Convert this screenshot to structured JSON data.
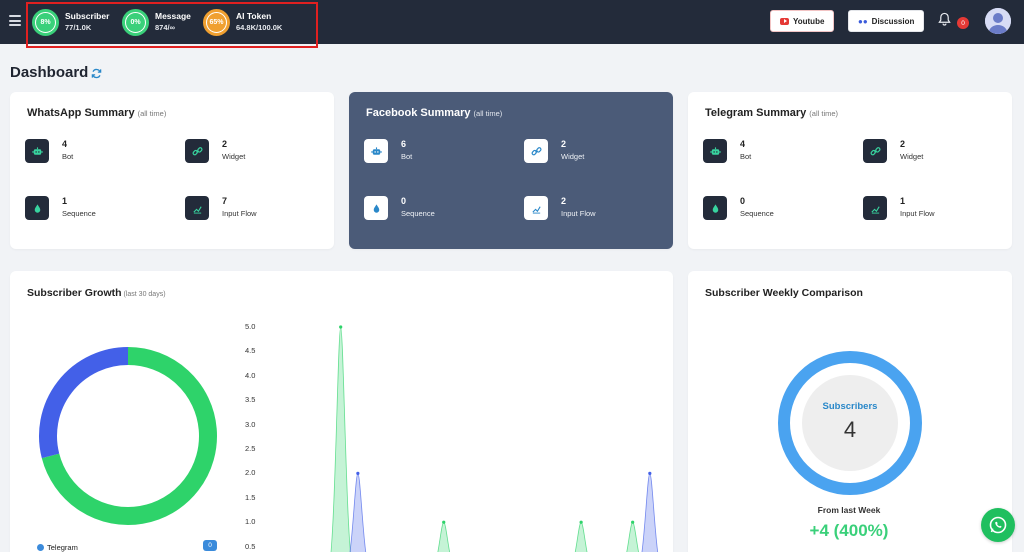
{
  "topbar": {
    "quotas": [
      {
        "percent_label": "8%",
        "title": "Subscriber",
        "value": "77/1.0K",
        "color": "#3ad07a"
      },
      {
        "percent_label": "0%",
        "title": "Message",
        "value": "874/∞",
        "color": "#3ad07a"
      },
      {
        "percent_label": "65%",
        "title": "AI Token",
        "value": "64.8K/100.0K",
        "color": "#f0a030"
      }
    ],
    "youtube_label": "Youtube",
    "discussion_label": "Discussion",
    "notification_count": "0"
  },
  "page": {
    "title": "Dashboard"
  },
  "summaries": [
    {
      "title": "WhatsApp Summary",
      "scope": "(all time)",
      "stats": [
        {
          "value": "4",
          "label": "Bot",
          "icon": "robot-icon"
        },
        {
          "value": "2",
          "label": "Widget",
          "icon": "link-icon"
        },
        {
          "value": "1",
          "label": "Sequence",
          "icon": "drop-icon"
        },
        {
          "value": "7",
          "label": "Input Flow",
          "icon": "flow-icon"
        }
      ]
    },
    {
      "title": "Facebook Summary",
      "scope": "(all time)",
      "stats": [
        {
          "value": "6",
          "label": "Bot",
          "icon": "robot-icon"
        },
        {
          "value": "2",
          "label": "Widget",
          "icon": "link-icon"
        },
        {
          "value": "0",
          "label": "Sequence",
          "icon": "drop-icon"
        },
        {
          "value": "2",
          "label": "Input Flow",
          "icon": "flow-icon"
        }
      ]
    },
    {
      "title": "Telegram Summary",
      "scope": "(all time)",
      "stats": [
        {
          "value": "4",
          "label": "Bot",
          "icon": "robot-icon"
        },
        {
          "value": "2",
          "label": "Widget",
          "icon": "link-icon"
        },
        {
          "value": "0",
          "label": "Sequence",
          "icon": "drop-icon"
        },
        {
          "value": "1",
          "label": "Input Flow",
          "icon": "flow-icon"
        }
      ]
    }
  ],
  "growth": {
    "title": "Subscriber Growth",
    "scope": "(last 30 days)",
    "legend": [
      {
        "name": "Telegram",
        "count": "0",
        "color": "#3b8bdb"
      }
    ]
  },
  "chart_data": [
    {
      "type": "pie",
      "donut": true,
      "slices": [
        {
          "share": 0.71,
          "color": "#2ed36a"
        },
        {
          "share": 0.29,
          "color": "#4360e8"
        }
      ]
    },
    {
      "type": "area",
      "ylim": [
        0,
        5.0
      ],
      "y_ticks": [
        "5.0",
        "4.5",
        "4.0",
        "3.5",
        "3.0",
        "2.5",
        "2.0",
        "1.5",
        "1.0",
        "0.5"
      ],
      "series": [
        {
          "color": "#2ed36a",
          "peaks": [
            {
              "x": 4,
              "y": 5.0
            },
            {
              "x": 10,
              "y": 1.0
            },
            {
              "x": 18,
              "y": 1.0
            },
            {
              "x": 21,
              "y": 1.0
            }
          ]
        },
        {
          "color": "#4360e8",
          "peaks": [
            {
              "x": 5,
              "y": 2.0
            },
            {
              "x": 22,
              "y": 2.0
            }
          ]
        }
      ],
      "x_range": [
        0,
        23
      ]
    }
  ],
  "weekly": {
    "title": "Subscriber Weekly Comparison",
    "center_label": "Subscribers",
    "center_value": "4",
    "from_label": "From last Week",
    "from_value": "+4 (400%)"
  }
}
